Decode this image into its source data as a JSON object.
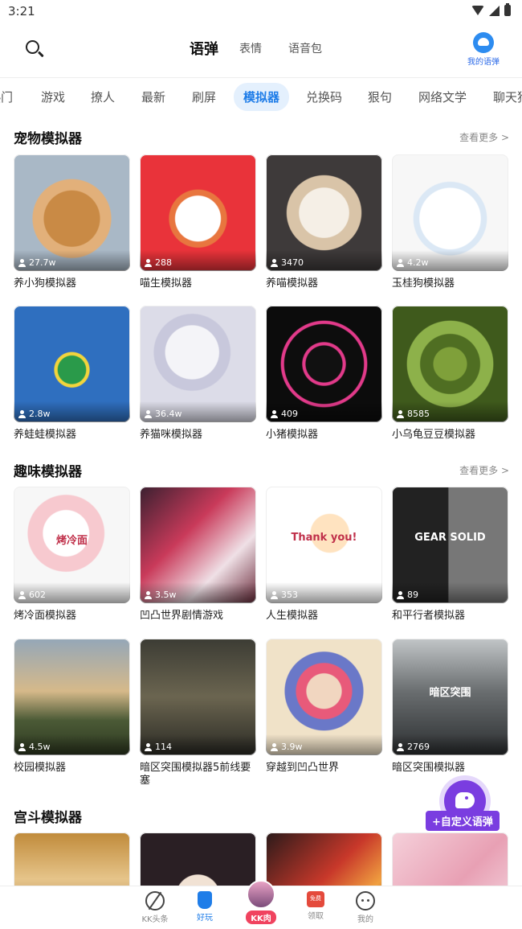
{
  "status_bar": {
    "time": "3:21"
  },
  "top_nav": {
    "tabs": [
      {
        "label": "语弹",
        "active": true
      },
      {
        "label": "表情",
        "active": false
      },
      {
        "label": "语音包",
        "active": false
      }
    ],
    "my_voice_label": "我的语弹"
  },
  "categories": [
    {
      "label": "热门",
      "active": false
    },
    {
      "label": "游戏",
      "active": false
    },
    {
      "label": "撩人",
      "active": false
    },
    {
      "label": "最新",
      "active": false
    },
    {
      "label": "刷屏",
      "active": false
    },
    {
      "label": "模拟器",
      "active": true
    },
    {
      "label": "兑换码",
      "active": false
    },
    {
      "label": "狠句",
      "active": false
    },
    {
      "label": "网络文学",
      "active": false
    },
    {
      "label": "聊天狗",
      "active": false
    }
  ],
  "sections": [
    {
      "title": "宠物模拟器",
      "see_more": "查看更多 >",
      "cards": [
        {
          "title": "养小狗模拟器",
          "count": "27.7w",
          "thumb": "pomeranian-dog"
        },
        {
          "title": "喵生模拟器",
          "count": "288",
          "thumb": "cartoon-cat"
        },
        {
          "title": "养喵模拟器",
          "count": "3470",
          "thumb": "kitten"
        },
        {
          "title": "玉桂狗模拟器",
          "count": "4.2w",
          "thumb": "cinnamoroll"
        },
        {
          "title": "养蛙蛙模拟器",
          "count": "2.8w",
          "thumb": "cartoon-frog"
        },
        {
          "title": "养猫咪模拟器",
          "count": "36.4w",
          "thumb": "sketch-cat"
        },
        {
          "title": "小猪模拟器",
          "count": "409",
          "thumb": "neon-pig"
        },
        {
          "title": "小乌龟豆豆模拟器",
          "count": "8585",
          "thumb": "turtle-shell"
        }
      ]
    },
    {
      "title": "趣味模拟器",
      "see_more": "查看更多 >",
      "cards": [
        {
          "title": "烤冷面模拟器",
          "count": "602",
          "thumb": "panda-noodles",
          "overlay_text": "烤冷面"
        },
        {
          "title": "凹凸世界剧情游戏",
          "count": "3.5w",
          "thumb": "anime-girl"
        },
        {
          "title": "人生模拟器",
          "count": "353",
          "thumb": "crayon-shin",
          "overlay_text": "Thank you!"
        },
        {
          "title": "和平行者模拟器",
          "count": "89",
          "thumb": "metal-gear",
          "overlay_text": "GEAR SOLID"
        },
        {
          "title": "校园模拟器",
          "count": "4.5w",
          "thumb": "campus-sunset"
        },
        {
          "title": "暗区突围模拟器5前线要塞",
          "count": "114",
          "thumb": "soldiers"
        },
        {
          "title": "穿越到凹凸世界",
          "count": "3.9w",
          "thumb": "anime-group"
        },
        {
          "title": "暗区突围模拟器",
          "count": "2769",
          "thumb": "soldier-helmet",
          "overlay_text": "暗区突围"
        }
      ]
    },
    {
      "title": "宫斗模拟器",
      "cards": [
        {
          "thumb": "palace-lady"
        },
        {
          "thumb": "palace-portrait"
        },
        {
          "thumb": "red-warrior"
        },
        {
          "thumb": "pink-lady"
        }
      ]
    }
  ],
  "fab": {
    "label": "+自定义语弹"
  },
  "bottom_bar": {
    "items": [
      {
        "label": "KK头条",
        "active": false
      },
      {
        "label": "好玩",
        "active": true
      },
      {
        "label": "KK肉",
        "active": false
      },
      {
        "label": "领取",
        "active": false
      },
      {
        "label": "我的",
        "active": false
      }
    ],
    "gift_badge": "免费"
  },
  "colors": {
    "accent": "#1f7de8",
    "fab": "#7a3de0",
    "highlight": "#ffe25a",
    "kk_badge": "#f0435f"
  }
}
